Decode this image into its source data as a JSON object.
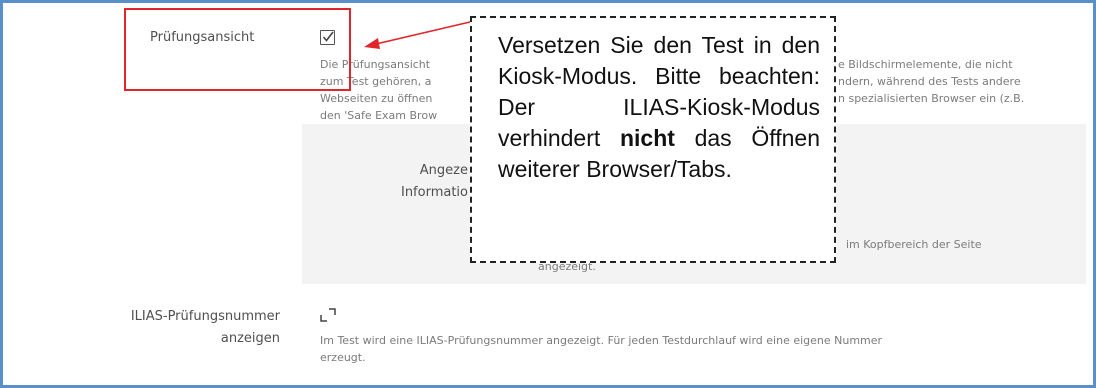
{
  "settings": {
    "exam_view": {
      "label": "Prüfungsansicht",
      "checked": true,
      "description_lines": [
        "Die Prüfungsansicht",
        "zum Test gehören, a",
        "Webseiten zu öffnen",
        "den 'Safe Exam Brow"
      ],
      "description_right_lines": [
        "e Bildschirmelemente, die nicht",
        "ndern, während des Tests andere",
        "n spezialisierten Browser ein (z.B."
      ]
    },
    "shown_info": {
      "label_lines": [
        "Angeze",
        "Informatio"
      ],
      "description_right": "im Kopfbereich der Seite",
      "description_bottom": "angezeigt."
    },
    "ilias_exam_number": {
      "label_lines": [
        "ILIAS-Prüfungsnummer",
        "anzeigen"
      ],
      "checked": false,
      "description_lines": [
        "Im Test wird eine ILIAS-Prüfungsnummer angezeigt. Für jeden Testdurchlauf wird eine eigene Nummer",
        "erzeugt."
      ]
    }
  },
  "callout": {
    "text_before": "Versetzen Sie den Test in den Kiosk-Modus. Bitte beachten: Der ILIAS-Kiosk-Modus verhindert ",
    "text_bold": "nicht",
    "text_after": " das Öffnen weiterer Browser/Tabs."
  },
  "colors": {
    "frame_border": "#5b8fc9",
    "highlight_box": "#e0262b",
    "arrow": "#e0262b"
  }
}
